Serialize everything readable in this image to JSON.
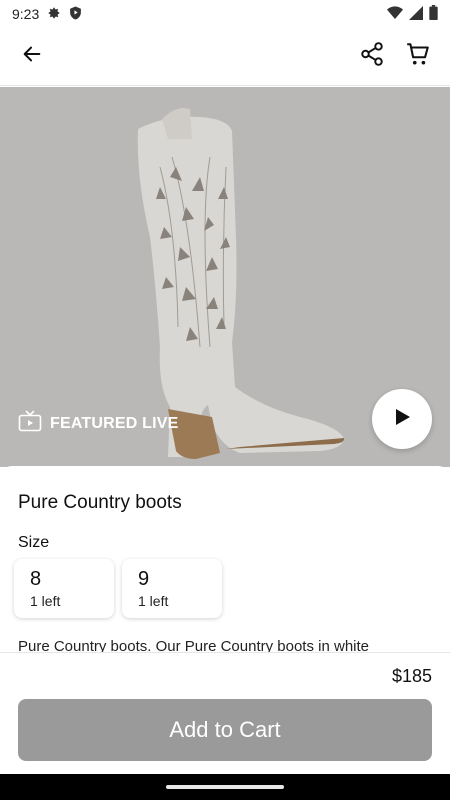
{
  "status_bar": {
    "time": "9:23",
    "left_icons": [
      "gear-icon",
      "shield-icon"
    ],
    "right_icons": [
      "wifi-icon",
      "signal-icon",
      "battery-icon"
    ]
  },
  "app_bar": {
    "icons": [
      "back-arrow-icon",
      "share-icon",
      "cart-icon"
    ]
  },
  "hero": {
    "featured_label": "FEATURED LIVE",
    "background_color": "#b9b8b7"
  },
  "product": {
    "title": "Pure Country boots",
    "size_label": "Size",
    "sizes": [
      {
        "size": "8",
        "stock": "1 left"
      },
      {
        "size": "9",
        "stock": "1 left"
      }
    ],
    "description": "Pure Country boots. Our Pure Country boots in white"
  },
  "purchase": {
    "price": "$185",
    "add_to_cart_label": "Add to Cart",
    "button_color": "#9a9a9a"
  }
}
